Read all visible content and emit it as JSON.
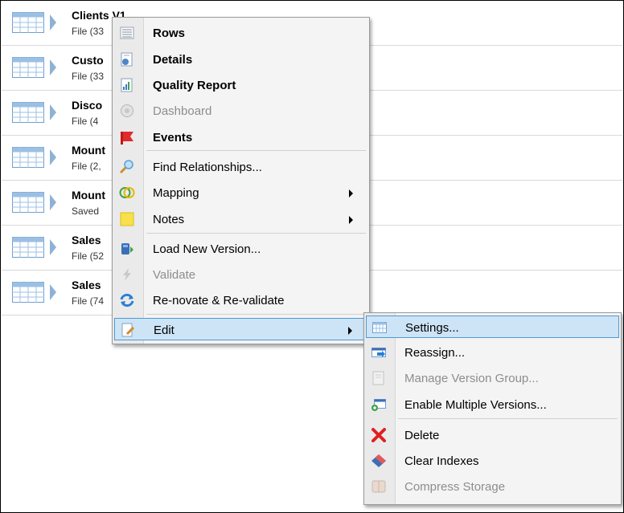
{
  "list": {
    "rows": [
      {
        "name": "Clients V1",
        "meta": "File (33"
      },
      {
        "name": "Custo",
        "meta": "File (33"
      },
      {
        "name": "Disco",
        "meta": "File (4"
      },
      {
        "name": "Mount",
        "meta": "File (2,"
      },
      {
        "name": "Mount",
        "meta": "Saved"
      },
      {
        "name": "Sales",
        "meta": "File (52"
      },
      {
        "name": "Sales",
        "meta": "File (74"
      }
    ]
  },
  "context_menu": {
    "items": [
      {
        "label": "Rows",
        "icon": "rows-icon",
        "bold": true,
        "enabled": true
      },
      {
        "label": "Details",
        "icon": "details-icon",
        "bold": true,
        "enabled": true
      },
      {
        "label": "Quality Report",
        "icon": "quality-report-icon",
        "bold": true,
        "enabled": true
      },
      {
        "label": "Dashboard",
        "icon": "dashboard-icon",
        "bold": false,
        "enabled": false
      },
      {
        "label": "Events",
        "icon": "flag-icon",
        "bold": true,
        "enabled": true
      },
      {
        "label": "Find Relationships...",
        "icon": "magnifier-icon",
        "bold": false,
        "enabled": true
      },
      {
        "label": "Mapping",
        "icon": "mapping-icon",
        "bold": false,
        "enabled": true,
        "submenu": true
      },
      {
        "label": "Notes",
        "icon": "notes-icon",
        "bold": false,
        "enabled": true,
        "submenu": true
      },
      {
        "label": "Load New Version...",
        "icon": "load-version-icon",
        "bold": false,
        "enabled": true
      },
      {
        "label": "Validate",
        "icon": "lightning-icon",
        "bold": false,
        "enabled": false
      },
      {
        "label": "Re-novate & Re-validate",
        "icon": "refresh-icon",
        "bold": false,
        "enabled": true
      },
      {
        "label": "Edit",
        "icon": "edit-icon",
        "bold": false,
        "enabled": true,
        "submenu": true,
        "highlighted": true
      }
    ]
  },
  "edit_submenu": {
    "items": [
      {
        "label": "Settings...",
        "icon": "settings-table-icon",
        "enabled": true,
        "highlighted": true
      },
      {
        "label": "Reassign...",
        "icon": "reassign-icon",
        "enabled": true
      },
      {
        "label": "Manage Version Group...",
        "icon": "version-group-icon",
        "enabled": false
      },
      {
        "label": "Enable Multiple Versions...",
        "icon": "multiple-versions-icon",
        "enabled": true
      },
      {
        "label": "Delete",
        "icon": "delete-x-icon",
        "enabled": true
      },
      {
        "label": "Clear Indexes",
        "icon": "eraser-icon",
        "enabled": true
      },
      {
        "label": "Compress Storage",
        "icon": "compress-icon",
        "enabled": false
      }
    ]
  },
  "colors": {
    "highlight_bg": "#cde4f7",
    "highlight_border": "#4d9ad4",
    "disabled_text": "#8d8d8d",
    "table_icon_blue": "#6f9fcf"
  }
}
